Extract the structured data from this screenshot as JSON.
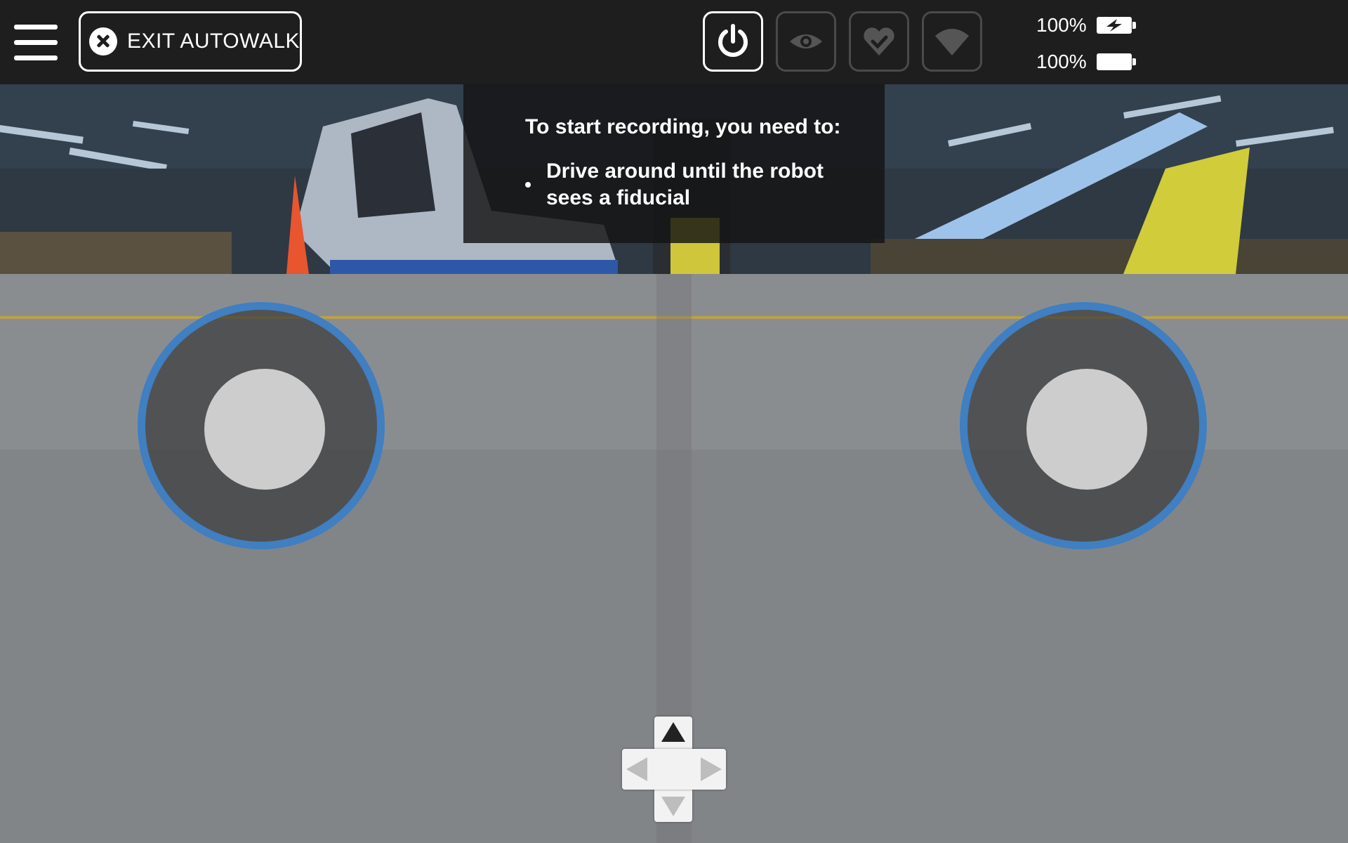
{
  "topbar": {
    "exit_label": "EXIT AUTOWALK",
    "status_icons": [
      "power-icon",
      "eye-icon",
      "heart-icon",
      "wifi-icon"
    ],
    "battery_robot_pct": "100%",
    "battery_tablet_pct": "100%"
  },
  "overlay": {
    "title": "To start recording, you need to:",
    "steps": [
      "Drive around until the robot sees a fiducial"
    ]
  },
  "colors": {
    "topbar_bg": "#1e1e1e",
    "joystick_ring": "#3f7fc2",
    "overlay_bg": "rgba(20,20,20,0.82)",
    "icon_inactive": "#4a4a4a"
  }
}
